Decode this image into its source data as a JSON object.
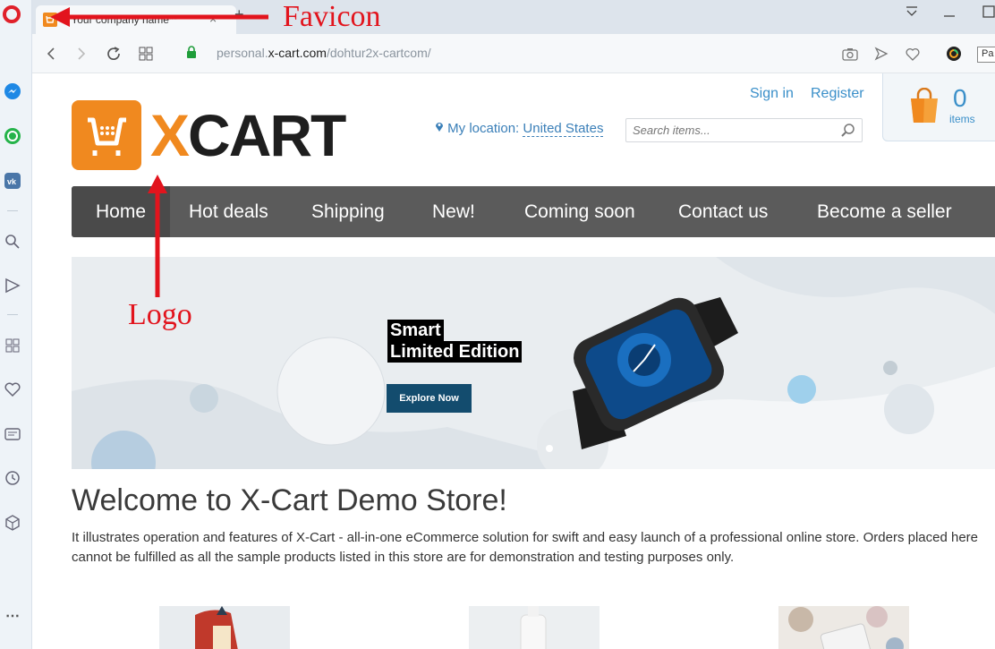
{
  "browser": {
    "tab_title": "**Your company name**",
    "tab_close": "×",
    "new_tab": "+",
    "url_prefix": "personal.",
    "url_domain": "x-cart.com",
    "url_path": "/dohtur2x-cartcom/",
    "tooltip": "Pa"
  },
  "header": {
    "logo_x": "X",
    "logo_rest": "CART",
    "sign_in": "Sign in",
    "register": "Register",
    "location_label": "My location:",
    "location_value": "United States",
    "search_placeholder": "Search items...",
    "cart_count": "0",
    "cart_label": "items"
  },
  "nav": {
    "items": [
      "Home",
      "Hot deals",
      "Shipping",
      "New!",
      "Coming soon",
      "Contact us",
      "Become a seller"
    ]
  },
  "banner": {
    "line1": "Smart",
    "line2": "Limited Edition",
    "button": "Explore Now"
  },
  "main": {
    "welcome": "Welcome to X-Cart Demo Store!",
    "description": "It illustrates operation and features of X-Cart - all-in-one eCommerce solution for swift and easy launch of a professional online store. Orders placed here cannot be fulfilled as all the sample products listed in this store are for demonstration and testing purposes only."
  },
  "annotations": {
    "favicon": "Favicon",
    "logo": "Logo"
  },
  "colors": {
    "accent": "#f0891f",
    "link": "#3a8fc9",
    "nav_bg": "#5b5b5b",
    "annotation": "#e2141d"
  }
}
